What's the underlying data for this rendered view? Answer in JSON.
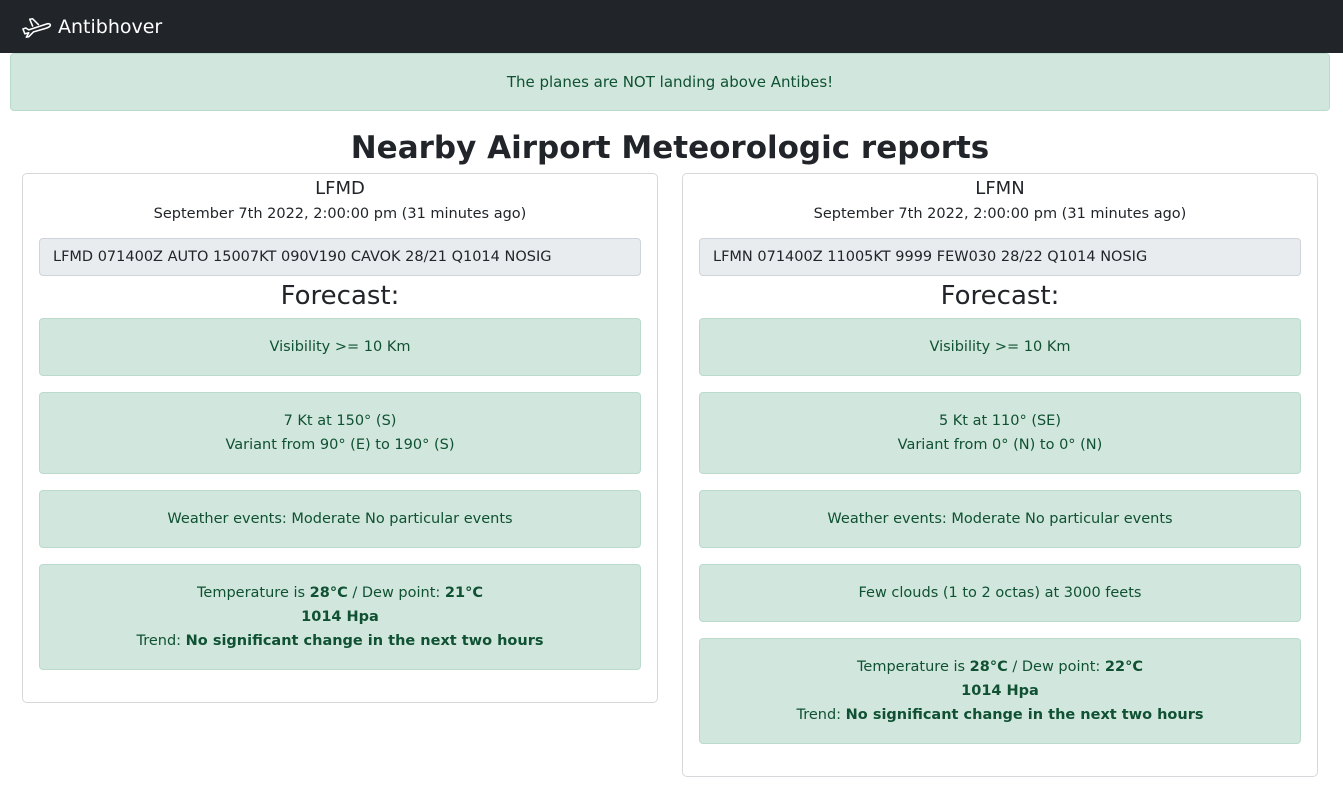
{
  "navbar": {
    "brand": "Antibhover",
    "brand_icon": "airplane-icon"
  },
  "alert": {
    "text": "The planes are NOT landing above Antibes!"
  },
  "page_title": "Nearby Airport Meteorologic reports",
  "forecast_label": "Forecast:",
  "airports": [
    {
      "code": "LFMD",
      "time": "September 7th 2022, 2:00:00 pm (31 minutes ago)",
      "metar": "LFMD 071400Z AUTO 15007KT 090V190 CAVOK 28/21 Q1014 NOSIG",
      "visibility": "Visibility >= 10 Km",
      "wind": "7 Kt at 150° (S)",
      "wind_variant": "Variant from 90° (E) to 190° (S)",
      "weather": "Weather events: Moderate No particular events",
      "temp_label": "Temperature is",
      "temp": "28°C",
      "dew_label": "/ Dew point:",
      "dew": "21°C",
      "pressure": "1014 Hpa",
      "trend_label": "Trend:",
      "trend": "No significant change in the next two hours"
    },
    {
      "code": "LFMN",
      "time": "September 7th 2022, 2:00:00 pm (31 minutes ago)",
      "metar": "LFMN 071400Z 11005KT 9999 FEW030 28/22 Q1014 NOSIG",
      "visibility": "Visibility >= 10 Km",
      "wind": "5 Kt at 110° (SE)",
      "wind_variant": "Variant from 0° (N) to 0° (N)",
      "weather": "Weather events: Moderate No particular events",
      "clouds": "Few clouds (1 to 2 octas) at 3000 feets",
      "temp_label": "Temperature is",
      "temp": "28°C",
      "dew_label": "/ Dew point:",
      "dew": "22°C",
      "pressure": "1014 Hpa",
      "trend_label": "Trend:",
      "trend": "No significant change in the next two hours"
    }
  ],
  "colors": {
    "navbar_bg": "#212529",
    "success_bg": "#d1e7dd",
    "success_text": "#0f5132",
    "metar_bg": "#e9ecef"
  }
}
